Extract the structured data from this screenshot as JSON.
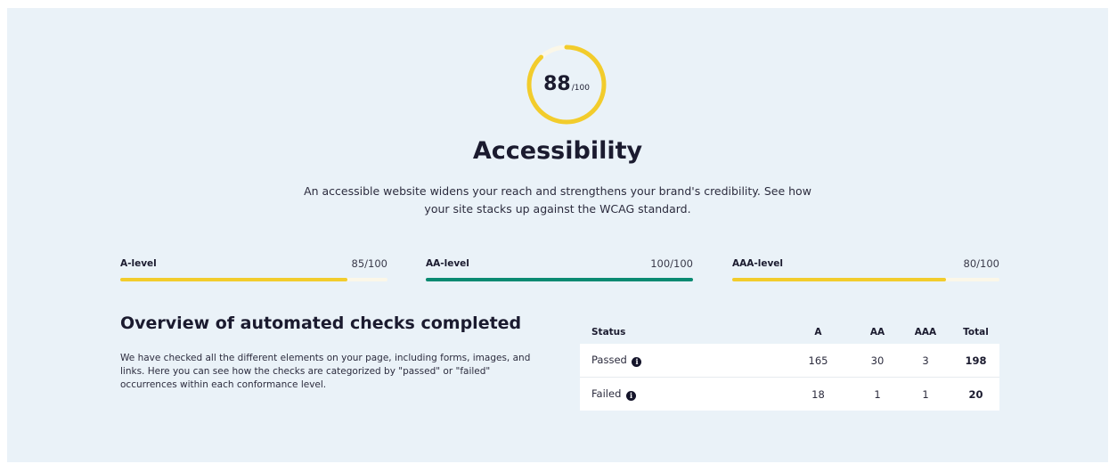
{
  "score": {
    "value": "88",
    "max_label": "/100",
    "fraction": 0.88,
    "ring_color": "#f2cc2c",
    "ring_track_color": "#fbf7e8"
  },
  "header": {
    "title": "Accessibility",
    "subtitle": "An accessible website widens your reach and strengthens your brand's credibility. See how your site stacks up against the WCAG standard."
  },
  "levels": [
    {
      "name": "A-level",
      "score": "85/100",
      "fraction": 0.85,
      "color": "#f2cc2c"
    },
    {
      "name": "AA-level",
      "score": "100/100",
      "fraction": 1.0,
      "color": "#0a8a72"
    },
    {
      "name": "AAA-level",
      "score": "80/100",
      "fraction": 0.8,
      "color": "#f2cc2c"
    }
  ],
  "overview": {
    "title": "Overview of automated checks completed",
    "description": "We have checked all the different elements on your page, including forms, images, and links. Here you can see how the checks are categorized by \"passed\" or \"failed\" occurrences within each conformance level."
  },
  "table": {
    "headers": [
      "Status",
      "A",
      "AA",
      "AAA",
      "Total"
    ],
    "rows": [
      {
        "status": "Passed",
        "a": "165",
        "aa": "30",
        "aaa": "3",
        "total": "198"
      },
      {
        "status": "Failed",
        "a": "18",
        "aa": "1",
        "aaa": "1",
        "total": "20"
      }
    ],
    "info_icon_glyph": "i"
  },
  "colors": {
    "panel_background": "#eaf2f8",
    "text_dark": "#1b1b2f"
  }
}
